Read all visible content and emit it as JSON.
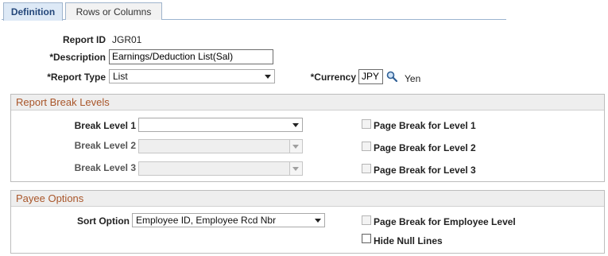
{
  "tabs": [
    {
      "label": "Definition"
    },
    {
      "label": "Rows or Columns"
    }
  ],
  "header": {
    "report_id_label": "Report ID",
    "report_id_value": "JGR01",
    "description_label": "*Description",
    "description_value": "Earnings/Deduction List(Sal)",
    "report_type_label": "*Report Type",
    "report_type_value": "List",
    "currency_label": "*Currency",
    "currency_value": "JPY",
    "currency_name": "Yen"
  },
  "break_levels": {
    "title": "Report Break Levels",
    "rows": [
      {
        "label": "Break Level 1",
        "value": "",
        "page_break_label": "Page Break for Level 1",
        "checked": false
      },
      {
        "label": "Break Level 2",
        "value": "",
        "page_break_label": "Page Break for Level 2",
        "checked": false
      },
      {
        "label": "Break Level 3",
        "value": "",
        "page_break_label": "Page Break for Level 3",
        "checked": false
      }
    ]
  },
  "payee": {
    "title": "Payee Options",
    "sort_label": "Sort Option",
    "sort_value": "Employee ID, Employee Rcd Nbr",
    "page_break_employee_label": "Page Break for Employee Level",
    "hide_null_label": "Hide Null Lines",
    "hide_null_checked": false
  },
  "icons": {
    "currency_lookup": "magnifier-icon"
  },
  "colors": {
    "group_title": "#a9562a",
    "tab_active_bg": "#dde9f6"
  }
}
